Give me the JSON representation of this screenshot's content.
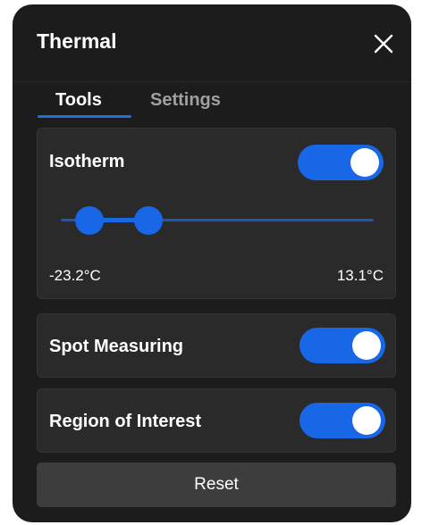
{
  "panel": {
    "title": "Thermal",
    "close_icon": "close-icon"
  },
  "tabs": [
    {
      "label": "Tools",
      "active": true
    },
    {
      "label": "Settings",
      "active": false
    }
  ],
  "isotherm": {
    "label": "Isotherm",
    "enabled": true,
    "range_min_label": "-23.2°C",
    "range_max_label": "13.1°C",
    "slider_low_fraction": 0.09,
    "slider_high_fraction": 0.28
  },
  "spot_measuring": {
    "label": "Spot Measuring",
    "enabled": true
  },
  "region_of_interest": {
    "label": "Region of Interest",
    "enabled": true
  },
  "reset_label": "Reset",
  "colors": {
    "accent": "#1767e6",
    "panel_bg": "#1c1c1c",
    "card_bg": "#2a2a2a",
    "button_bg": "#3d3d3d"
  }
}
